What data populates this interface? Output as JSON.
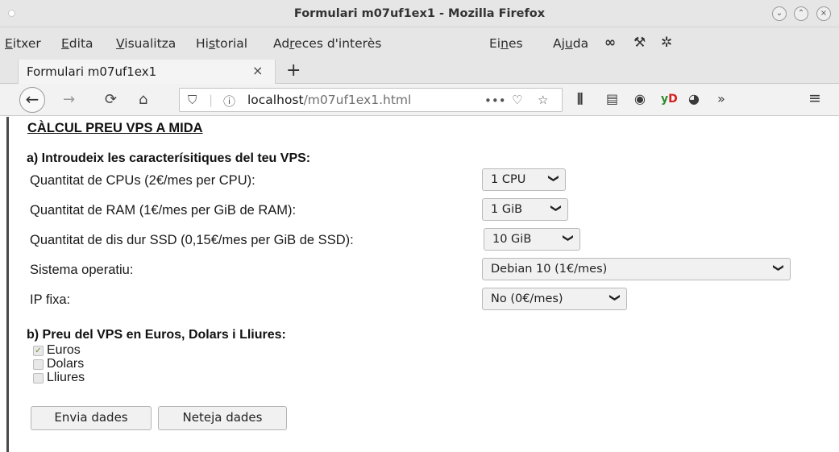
{
  "window": {
    "title": "Formulari m07uf1ex1 - Mozilla Firefox",
    "controls": [
      "minimize",
      "maximize",
      "close"
    ]
  },
  "menubar": {
    "items": [
      {
        "pre": "",
        "u": "E",
        "post": "itxer"
      },
      {
        "pre": "",
        "u": "E",
        "post": "dita"
      },
      {
        "pre": "",
        "u": "V",
        "post": "isualitza"
      },
      {
        "pre": "Hi",
        "u": "s",
        "post": "torial"
      },
      {
        "pre": "Ad",
        "u": "r",
        "post": "eces d'interès"
      },
      {
        "pre": "Ei",
        "u": "n",
        "post": "es"
      },
      {
        "pre": "Aj",
        "u": "u",
        "post": "da"
      }
    ],
    "icons": [
      "mask-icon",
      "wrench-icon",
      "gear-icon"
    ]
  },
  "tabs": {
    "active_label": "Formulari m07uf1ex1",
    "close_glyph": "×",
    "new_tab_glyph": "+"
  },
  "navbar": {
    "url_host": "localhost",
    "url_path": "/m07uf1ex1.html",
    "more_glyph": "•••",
    "addon_label": "yD"
  },
  "form": {
    "title": "CÀLCUL PREU VPS A MIDA",
    "section_a": "a) Introudeix les caracterísitiques del teu VPS:",
    "fields": [
      {
        "label": "Quantitat de CPUs (2€/mes per CPU):",
        "value": "1 CPU"
      },
      {
        "label": "Quantitat de RAM (1€/mes per GiB de RAM):",
        "value": "1 GiB"
      },
      {
        "label": "Quantitat de dis dur SSD (0,15€/mes per GiB de SSD):",
        "value": "10 GiB"
      },
      {
        "label": "Sistema operatiu:",
        "value": "Debian 10 (1€/mes)"
      },
      {
        "label": "IP fixa:",
        "value": "No (0€/mes)"
      }
    ],
    "section_b": "b) Preu del VPS en Euros, Dolars i Lliures:",
    "currencies": [
      {
        "label": "Euros",
        "checked": true
      },
      {
        "label": "Dolars",
        "checked": false
      },
      {
        "label": "Lliures",
        "checked": false
      }
    ],
    "submit_label": "Envia dades",
    "reset_label": "Neteja dades"
  }
}
